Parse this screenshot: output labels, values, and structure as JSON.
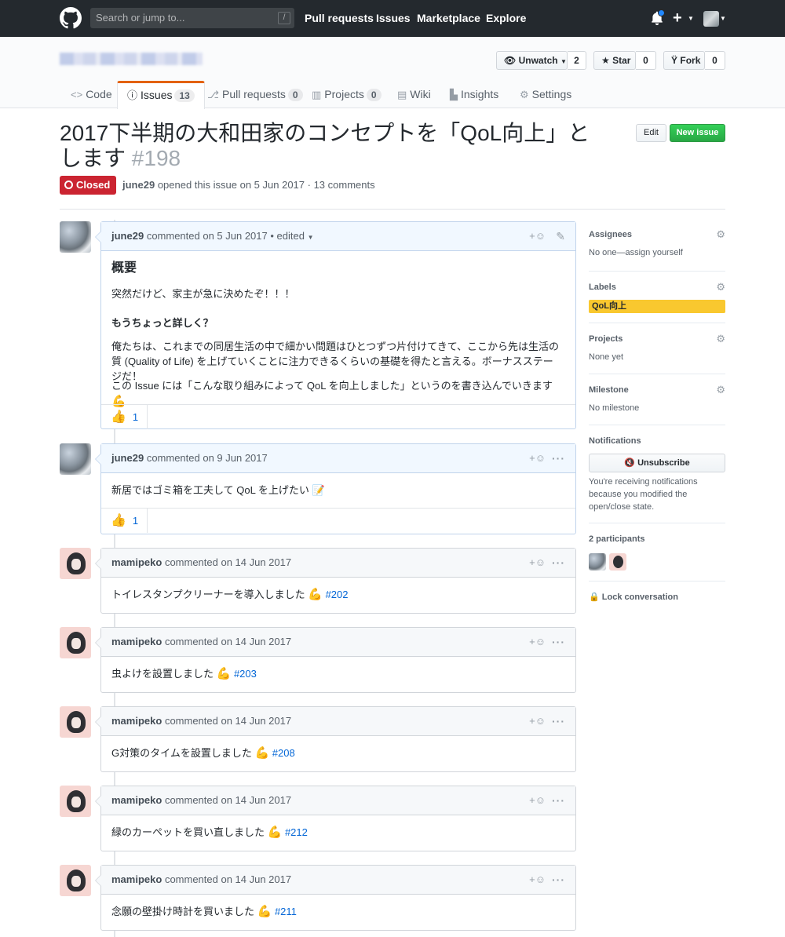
{
  "header": {
    "search_placeholder": "Search or jump to...",
    "search_key": "/",
    "nav": [
      "Pull requests",
      "Issues",
      "Marketplace",
      "Explore"
    ]
  },
  "repo": {
    "unwatch_label": "Unwatch",
    "unwatch_count": "2",
    "star_label": "Star",
    "star_count": "0",
    "fork_label": "Fork",
    "fork_count": "0",
    "tabs": [
      {
        "label": "Code",
        "icon": "code-icon"
      },
      {
        "label": "Issues",
        "count": "13",
        "icon": "issue-icon"
      },
      {
        "label": "Pull requests",
        "count": "0",
        "icon": "pr-icon"
      },
      {
        "label": "Projects",
        "count": "0",
        "icon": "project-icon"
      },
      {
        "label": "Wiki",
        "icon": "book-icon"
      },
      {
        "label": "Insights",
        "icon": "graph-icon"
      },
      {
        "label": "Settings",
        "icon": "gear-icon"
      }
    ]
  },
  "issue": {
    "title": "2017下半期の大和田家のコンセプトを「QoL向上」とします",
    "number": "#198",
    "edit_label": "Edit",
    "new_issue_label": "New issue",
    "state": "Closed",
    "author": "june29",
    "meta_text": "opened this issue on 5 Jun 2017 · 13 comments"
  },
  "comments": [
    {
      "author": "june29",
      "text": "commented on 5 Jun 2017",
      "edited": "• edited",
      "heading": "概要",
      "p1": "突然だけど、家主が急に決めたぞ！！！",
      "subheading": "もうちょっと詳しく？",
      "p2": "俺たちは、これまでの同居生活の中で細かい問題はひとつずつ片付けてきて、ここから先は生活の質 (Quality of Life) を上げていくことに注力できるくらいの基礎を得たと言える。ボーナスステージだ！",
      "p3": "この Issue には「こんな取り組みによって QoL を向上しました」というのを書き込んでいきます",
      "reaction_count": "1"
    },
    {
      "author": "june29",
      "text": "commented on 9 Jun 2017",
      "body": "新居ではゴミ箱を工夫して QoL を上げたい",
      "reaction_count": "1"
    },
    {
      "author": "mamipeko",
      "text": "commented on 14 Jun 2017",
      "body": "トイレスタンプクリーナーを導入しました",
      "ref": "#202"
    },
    {
      "author": "mamipeko",
      "text": "commented on 14 Jun 2017",
      "body": "虫よけを設置しました",
      "ref": "#203"
    },
    {
      "author": "mamipeko",
      "text": "commented on 14 Jun 2017",
      "body": "G対策のタイムを設置しました",
      "ref": "#208"
    },
    {
      "author": "mamipeko",
      "text": "commented on 14 Jun 2017",
      "body": "緑のカーペットを買い直しました",
      "ref": "#212"
    },
    {
      "author": "mamipeko",
      "text": "commented on 14 Jun 2017",
      "body": "念願の壁掛け時計を買いました",
      "ref": "#211"
    }
  ],
  "sidebar": {
    "assignees_title": "Assignees",
    "assignees_value": "No one—assign yourself",
    "labels_title": "Labels",
    "label_name": "QoL向上",
    "label_color": "#f9c82f",
    "projects_title": "Projects",
    "projects_value": "None yet",
    "milestone_title": "Milestone",
    "milestone_value": "No milestone",
    "notifications_title": "Notifications",
    "unsubscribe_label": "Unsubscribe",
    "notifications_text": "You're receiving notifications because you modified the open/close state.",
    "participants_title": "2 participants",
    "lock_label": "Lock conversation"
  },
  "colors": {
    "header_bg": "#24292e",
    "closed_red": "#cb2431",
    "new_issue_green": "#28a745",
    "link_blue": "#0366d6"
  }
}
